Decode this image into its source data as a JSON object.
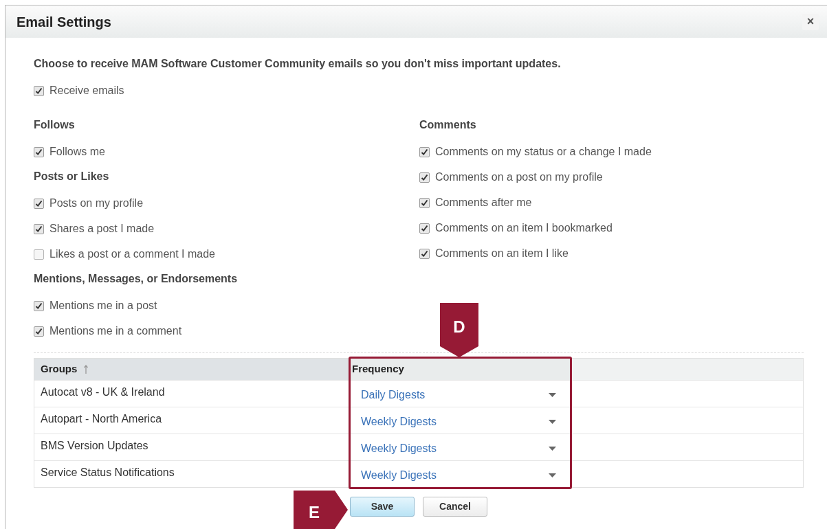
{
  "dialog": {
    "title": "Email Settings",
    "close_label": "×"
  },
  "intro": "Choose to receive MAM Software Customer Community emails so you don't miss important updates.",
  "receive_emails": {
    "label": "Receive emails",
    "checked": true
  },
  "columns": [
    {
      "sections": [
        {
          "heading": "Follows",
          "options": [
            {
              "label": "Follows me",
              "checked": true
            }
          ]
        },
        {
          "heading": "Posts or Likes",
          "options": [
            {
              "label": "Posts on my profile",
              "checked": true
            },
            {
              "label": "Shares a post I made",
              "checked": true
            },
            {
              "label": "Likes a post or a comment I made",
              "checked": false
            }
          ]
        },
        {
          "heading": "Mentions, Messages, or Endorsements",
          "options": [
            {
              "label": "Mentions me in a post",
              "checked": true
            },
            {
              "label": "Mentions me in a comment",
              "checked": true
            }
          ]
        }
      ]
    },
    {
      "sections": [
        {
          "heading": "Comments",
          "options": [
            {
              "label": "Comments on my status or a change I made",
              "checked": true
            },
            {
              "label": "Comments on a post on my profile",
              "checked": true
            },
            {
              "label": "Comments after me",
              "checked": true
            },
            {
              "label": "Comments on an item I bookmarked",
              "checked": true
            },
            {
              "label": "Comments on an item I like",
              "checked": true
            }
          ]
        }
      ]
    }
  ],
  "table": {
    "columns": [
      {
        "label": "Groups",
        "sorted": true
      },
      {
        "label": "Frequency",
        "sorted": false
      }
    ],
    "rows": [
      {
        "group": "Autocat v8 - UK & Ireland",
        "frequency": "Daily Digests"
      },
      {
        "group": "Autopart - North America",
        "frequency": "Weekly Digests"
      },
      {
        "group": "BMS Version Updates",
        "frequency": "Weekly Digests"
      },
      {
        "group": "Service Status Notifications",
        "frequency": "Weekly Digests"
      }
    ]
  },
  "buttons": [
    {
      "label": "Save",
      "kind": "primary"
    },
    {
      "label": "Cancel",
      "kind": "secondary"
    }
  ],
  "callouts": [
    {
      "label": "D",
      "kind": "down"
    },
    {
      "label": "E",
      "kind": "right"
    }
  ]
}
